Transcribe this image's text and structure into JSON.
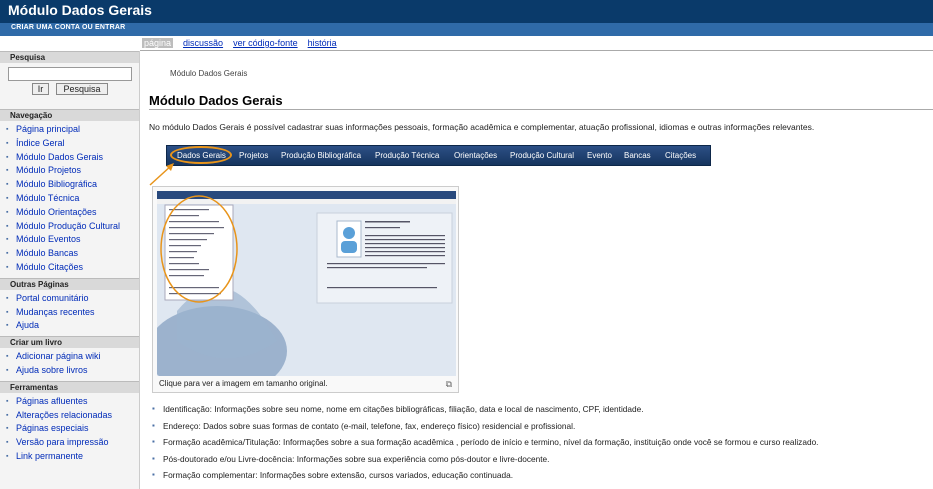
{
  "header": {
    "title": "Módulo Dados Gerais",
    "create_account": "CRIAR UMA CONTA OU ENTRAR"
  },
  "tabs": [
    {
      "label": "página"
    },
    {
      "label": "discussão"
    },
    {
      "label": "ver código-fonte"
    },
    {
      "label": "história"
    }
  ],
  "sidebar": {
    "search": {
      "heading": "Pesquisa",
      "go_label": "Ir",
      "search_label": "Pesquisa"
    },
    "navigation": {
      "heading": "Navegação",
      "items": [
        {
          "label": "Página principal"
        },
        {
          "label": "Índice Geral"
        },
        {
          "label": "Módulo Dados Gerais"
        },
        {
          "label": "Módulo Projetos"
        },
        {
          "label": "Módulo Bibliográfica"
        },
        {
          "label": "Módulo Técnica"
        },
        {
          "label": "Módulo Orientações"
        },
        {
          "label": "Módulo Produção Cultural"
        },
        {
          "label": "Módulo Eventos"
        },
        {
          "label": "Módulo Bancas"
        },
        {
          "label": "Módulo Citações"
        }
      ]
    },
    "other_pages": {
      "heading": "Outras Páginas",
      "items": [
        {
          "label": "Portal comunitário"
        },
        {
          "label": "Mudanças recentes"
        },
        {
          "label": "Ajuda"
        }
      ]
    },
    "create_book": {
      "heading": "Criar um livro",
      "items": [
        {
          "label": "Adicionar página wiki"
        },
        {
          "label": "Ajuda sobre livros"
        }
      ]
    },
    "tools": {
      "heading": "Ferramentas",
      "items": [
        {
          "label": "Páginas afluentes"
        },
        {
          "label": "Alterações relacionadas"
        },
        {
          "label": "Páginas especiais"
        },
        {
          "label": "Versão para impressão"
        },
        {
          "label": "Link permanente"
        }
      ]
    }
  },
  "content": {
    "breadcrumb": "Módulo Dados Gerais",
    "title": "Módulo Dados Gerais",
    "intro": "No módulo Dados Gerais é possível cadastrar suas informações pessoais, formação acadêmica e complementar, atuação profissional, idiomas e outras informações relevantes.",
    "menubar": [
      "Dados Gerais",
      "Projetos",
      "Produção Bibliográfica",
      "Produção Técnica",
      "Orientações",
      "Produção Cultural",
      "Evento",
      "Bancas",
      "Citações"
    ],
    "thumbnail_caption": "Clique para ver a imagem em tamanho original.",
    "bullets": [
      {
        "text": "Identificação: Informações sobre seu nome, nome em citações bibliográficas, filiação, data e local de nascimento, CPF, identidade."
      },
      {
        "text": "Endereço: Dados sobre suas formas de contato (e-mail, telefone, fax, endereço físico) residencial e profissional."
      },
      {
        "text": "Formação acadêmica/Titulação: Informações sobre a sua formação acadêmica , período de início e termino, nível da formação, instituição onde você se formou e curso realizado."
      },
      {
        "text": "Pós-doutorado e/ou Livre-docência: Informações sobre sua experiência como pós-doutor e livre-docente."
      },
      {
        "text": "Formação complementar: Informações sobre extensão, cursos variados, educação continuada."
      }
    ]
  },
  "colors": {
    "header_bg": "#0a3a6a",
    "subheader_bg": "#2f6aa8",
    "link": "#002bb8",
    "highlight": "#e8941a"
  }
}
